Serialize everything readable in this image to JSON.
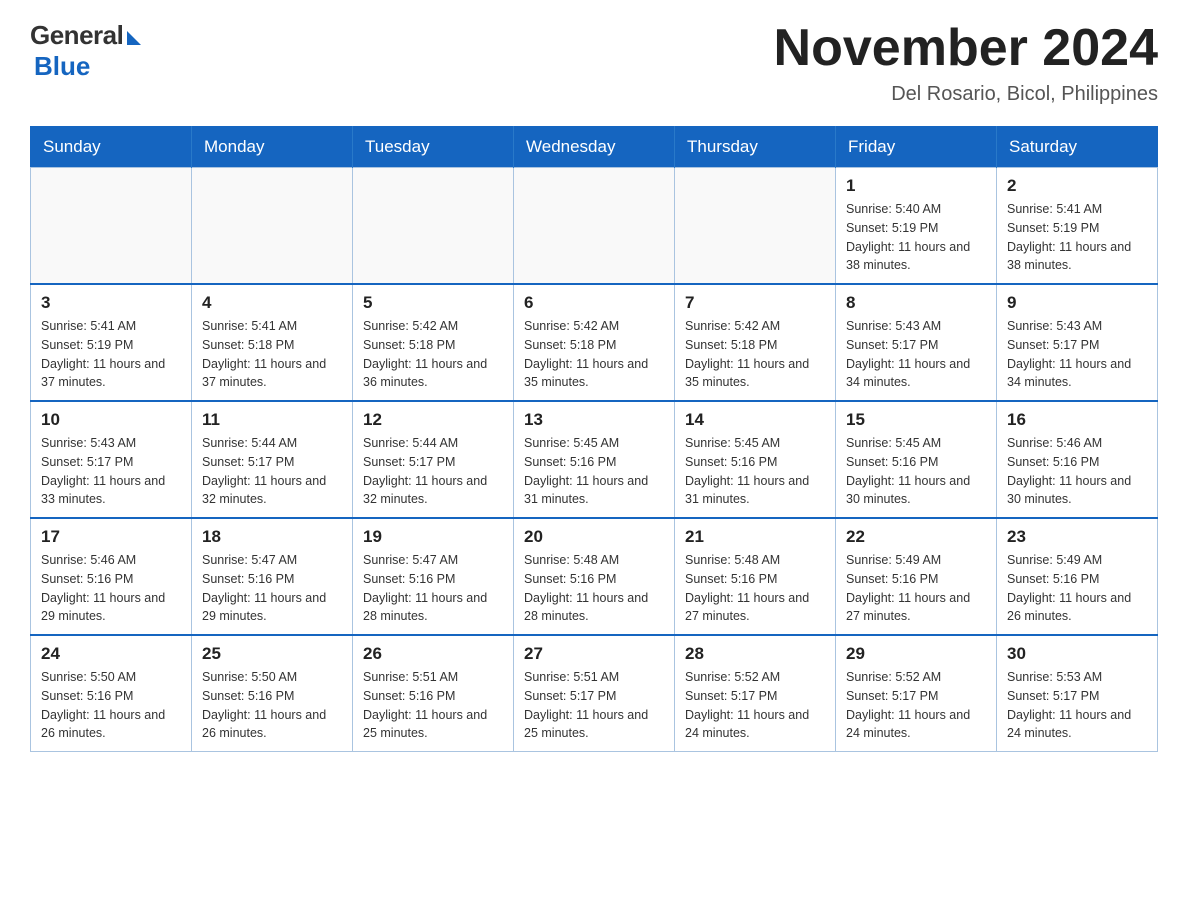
{
  "header": {
    "logo": {
      "general": "General",
      "blue": "Blue"
    },
    "title": "November 2024",
    "location": "Del Rosario, Bicol, Philippines"
  },
  "calendar": {
    "days_of_week": [
      "Sunday",
      "Monday",
      "Tuesday",
      "Wednesday",
      "Thursday",
      "Friday",
      "Saturday"
    ],
    "weeks": [
      [
        {
          "day": "",
          "info": ""
        },
        {
          "day": "",
          "info": ""
        },
        {
          "day": "",
          "info": ""
        },
        {
          "day": "",
          "info": ""
        },
        {
          "day": "",
          "info": ""
        },
        {
          "day": "1",
          "info": "Sunrise: 5:40 AM\nSunset: 5:19 PM\nDaylight: 11 hours and 38 minutes."
        },
        {
          "day": "2",
          "info": "Sunrise: 5:41 AM\nSunset: 5:19 PM\nDaylight: 11 hours and 38 minutes."
        }
      ],
      [
        {
          "day": "3",
          "info": "Sunrise: 5:41 AM\nSunset: 5:19 PM\nDaylight: 11 hours and 37 minutes."
        },
        {
          "day": "4",
          "info": "Sunrise: 5:41 AM\nSunset: 5:18 PM\nDaylight: 11 hours and 37 minutes."
        },
        {
          "day": "5",
          "info": "Sunrise: 5:42 AM\nSunset: 5:18 PM\nDaylight: 11 hours and 36 minutes."
        },
        {
          "day": "6",
          "info": "Sunrise: 5:42 AM\nSunset: 5:18 PM\nDaylight: 11 hours and 35 minutes."
        },
        {
          "day": "7",
          "info": "Sunrise: 5:42 AM\nSunset: 5:18 PM\nDaylight: 11 hours and 35 minutes."
        },
        {
          "day": "8",
          "info": "Sunrise: 5:43 AM\nSunset: 5:17 PM\nDaylight: 11 hours and 34 minutes."
        },
        {
          "day": "9",
          "info": "Sunrise: 5:43 AM\nSunset: 5:17 PM\nDaylight: 11 hours and 34 minutes."
        }
      ],
      [
        {
          "day": "10",
          "info": "Sunrise: 5:43 AM\nSunset: 5:17 PM\nDaylight: 11 hours and 33 minutes."
        },
        {
          "day": "11",
          "info": "Sunrise: 5:44 AM\nSunset: 5:17 PM\nDaylight: 11 hours and 32 minutes."
        },
        {
          "day": "12",
          "info": "Sunrise: 5:44 AM\nSunset: 5:17 PM\nDaylight: 11 hours and 32 minutes."
        },
        {
          "day": "13",
          "info": "Sunrise: 5:45 AM\nSunset: 5:16 PM\nDaylight: 11 hours and 31 minutes."
        },
        {
          "day": "14",
          "info": "Sunrise: 5:45 AM\nSunset: 5:16 PM\nDaylight: 11 hours and 31 minutes."
        },
        {
          "day": "15",
          "info": "Sunrise: 5:45 AM\nSunset: 5:16 PM\nDaylight: 11 hours and 30 minutes."
        },
        {
          "day": "16",
          "info": "Sunrise: 5:46 AM\nSunset: 5:16 PM\nDaylight: 11 hours and 30 minutes."
        }
      ],
      [
        {
          "day": "17",
          "info": "Sunrise: 5:46 AM\nSunset: 5:16 PM\nDaylight: 11 hours and 29 minutes."
        },
        {
          "day": "18",
          "info": "Sunrise: 5:47 AM\nSunset: 5:16 PM\nDaylight: 11 hours and 29 minutes."
        },
        {
          "day": "19",
          "info": "Sunrise: 5:47 AM\nSunset: 5:16 PM\nDaylight: 11 hours and 28 minutes."
        },
        {
          "day": "20",
          "info": "Sunrise: 5:48 AM\nSunset: 5:16 PM\nDaylight: 11 hours and 28 minutes."
        },
        {
          "day": "21",
          "info": "Sunrise: 5:48 AM\nSunset: 5:16 PM\nDaylight: 11 hours and 27 minutes."
        },
        {
          "day": "22",
          "info": "Sunrise: 5:49 AM\nSunset: 5:16 PM\nDaylight: 11 hours and 27 minutes."
        },
        {
          "day": "23",
          "info": "Sunrise: 5:49 AM\nSunset: 5:16 PM\nDaylight: 11 hours and 26 minutes."
        }
      ],
      [
        {
          "day": "24",
          "info": "Sunrise: 5:50 AM\nSunset: 5:16 PM\nDaylight: 11 hours and 26 minutes."
        },
        {
          "day": "25",
          "info": "Sunrise: 5:50 AM\nSunset: 5:16 PM\nDaylight: 11 hours and 26 minutes."
        },
        {
          "day": "26",
          "info": "Sunrise: 5:51 AM\nSunset: 5:16 PM\nDaylight: 11 hours and 25 minutes."
        },
        {
          "day": "27",
          "info": "Sunrise: 5:51 AM\nSunset: 5:17 PM\nDaylight: 11 hours and 25 minutes."
        },
        {
          "day": "28",
          "info": "Sunrise: 5:52 AM\nSunset: 5:17 PM\nDaylight: 11 hours and 24 minutes."
        },
        {
          "day": "29",
          "info": "Sunrise: 5:52 AM\nSunset: 5:17 PM\nDaylight: 11 hours and 24 minutes."
        },
        {
          "day": "30",
          "info": "Sunrise: 5:53 AM\nSunset: 5:17 PM\nDaylight: 11 hours and 24 minutes."
        }
      ]
    ]
  }
}
